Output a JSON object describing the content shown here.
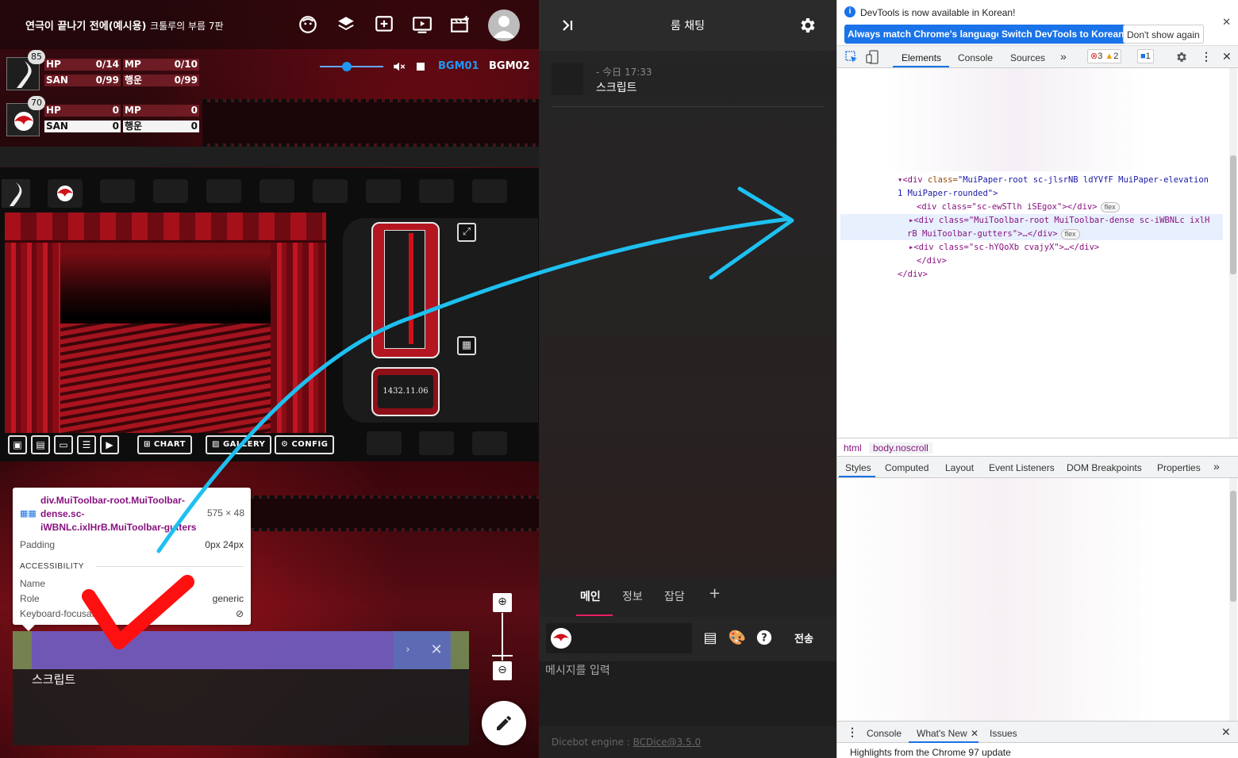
{
  "game": {
    "room_title": "연극이 끝나기 전에(예시용)",
    "room_subtitle": "크툴루의 부름 7판",
    "characters": [
      {
        "badge": "85",
        "stats": [
          {
            "name": "HP",
            "value": "0/14"
          },
          {
            "name": "MP",
            "value": "0/10"
          },
          {
            "name": "SAN",
            "value": "0/99"
          },
          {
            "name": "행운",
            "value": "0/99"
          }
        ]
      },
      {
        "badge": "70",
        "stats": [
          {
            "name": "HP",
            "value": "0"
          },
          {
            "name": "MP",
            "value": "0"
          },
          {
            "name": "SAN",
            "value": "0"
          },
          {
            "name": "행운",
            "value": "0"
          }
        ]
      }
    ],
    "volume_level": 0.42,
    "bgm_buttons": [
      "BGM01",
      "BGM02"
    ],
    "ticket_date": "1432.11.06",
    "menu_buttons": [
      "CHART",
      "GALLERY",
      "CONFIG"
    ],
    "chat_window_text": "스크립트",
    "colors": {
      "accent_blue": "#2196f3",
      "highlight_padding": "#6e50c8",
      "highlight_margin": "#7896 5a"
    }
  },
  "tooltip": {
    "selector": "div.MuiToolbar-root.MuiToolbar-dense.sc-iWBNLc.ixlHrB.MuiToolbar-gutters",
    "size": "575 × 48",
    "padding_label": "Padding",
    "padding_value": "0px 24px",
    "section": "ACCESSIBILITY",
    "name_label": "Name",
    "role_label": "Role",
    "role_value": "generic",
    "keyboard_label": "Keyboard-focusable"
  },
  "chat": {
    "title": "룸 채팅",
    "message": {
      "time": "- 今日 17:33",
      "body": "스크립트"
    },
    "tabs": [
      "메인",
      "정보",
      "잡담"
    ],
    "send_label": "전송",
    "input_placeholder": "메시지를 입력",
    "footer_prefix": "Dicebot engine : ",
    "footer_link": "BCDice@3.5.0"
  },
  "devtools": {
    "info_text": "DevTools is now available in Korean!",
    "btn_match": "Always match Chrome's language",
    "btn_switch": "Switch DevTools to Korean",
    "btn_dont_show": "Don't show again",
    "tabs": [
      "Elements",
      "Console",
      "Sources"
    ],
    "errors": "3",
    "warnings": "2",
    "messages": "1",
    "dom": {
      "line1_tag": "<div",
      "line1_attr": "class=",
      "line1_val": "\"MuiPaper-root sc-jlsrNB ldYVfF MuiPaper-elevation",
      "line1b": "1 MuiPaper-rounded\">",
      "line2": "<div class=\"sc-ewSTlh iSEgox\"></div>",
      "line3a": "<div class=\"MuiToolbar-root MuiToolbar-dense sc-iWBNLc ixlH",
      "line3b": "rB MuiToolbar-gutters\">…</div>",
      "line4": "<div class=\"sc-hYQoXb cvajyX\">…</div>",
      "line5": "</div>",
      "line6": "</div>",
      "flex": "flex"
    },
    "crumbs": [
      "html",
      "body.noscroll"
    ],
    "style_tabs": [
      "Styles",
      "Computed",
      "Layout",
      "Event Listeners",
      "DOM Breakpoints",
      "Properties"
    ],
    "drawer_tabs": [
      "Console",
      "What's New",
      "Issues"
    ],
    "drawer_text": "Highlights from the Chrome 97 update"
  }
}
